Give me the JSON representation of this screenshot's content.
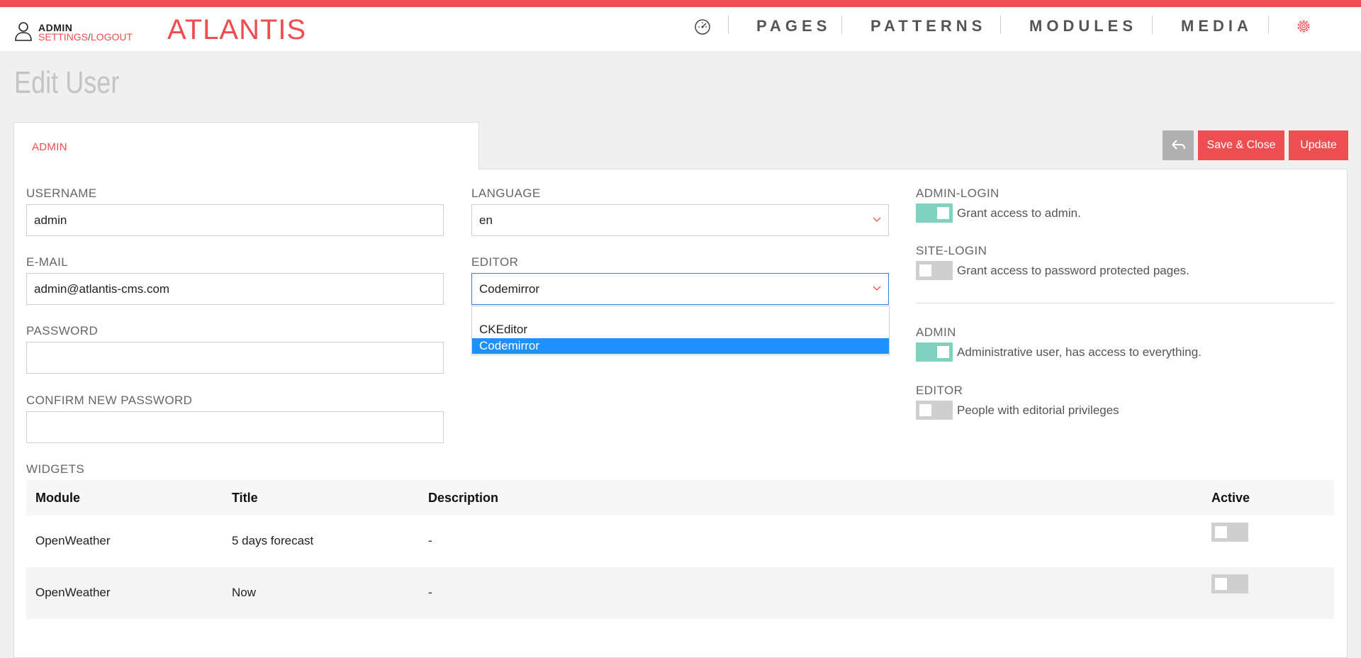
{
  "header": {
    "user_name": "ADMIN",
    "settings_link": "SETTINGS",
    "separator": "/",
    "logout_link": "LOGOUT",
    "logo": "ATLANTIS",
    "nav": [
      "PAGES",
      "PATTERNS",
      "MODULES",
      "MEDIA"
    ],
    "icons": {
      "user": "user-icon",
      "dashboard": "dashboard-gauge-icon",
      "settings": "gear-icon"
    },
    "accent_color": "#ef4e51"
  },
  "page": {
    "title": "Edit User"
  },
  "tab": {
    "label": "ADMIN"
  },
  "toolbar": {
    "back_icon": "reply-arrow-icon",
    "save_close": "Save & Close",
    "update": "Update"
  },
  "form": {
    "username_label": "USERNAME",
    "username_value": "admin",
    "email_label": "E-MAIL",
    "email_value": "admin@atlantis-cms.com",
    "password_label": "PASSWORD",
    "password_value": "",
    "confirm_label": "CONFIRM NEW PASSWORD",
    "confirm_value": "",
    "language_label": "LANGUAGE",
    "language_value": "en",
    "editor_label": "EDITOR",
    "editor_value": "Codemirror",
    "editor_options": [
      "CKEditor",
      "Codemirror"
    ],
    "editor_selected_option": "Codemirror"
  },
  "permissions": [
    {
      "label": "ADMIN-LOGIN",
      "description": "Grant access to admin.",
      "enabled": true
    },
    {
      "label": "SITE-LOGIN",
      "description": "Grant access to password protected pages.",
      "enabled": false
    },
    {
      "label": "ADMIN",
      "description": "Administrative user, has access to everything.",
      "enabled": true
    },
    {
      "label": "EDITOR",
      "description": "People with editorial privileges",
      "enabled": false
    }
  ],
  "toggle_colors": {
    "on": "#7ed3bf",
    "off": "#cfcfcf"
  },
  "widgets": {
    "label": "WIDGETS",
    "columns": [
      "Module",
      "Title",
      "Description",
      "Active"
    ],
    "rows": [
      {
        "module": "OpenWeather",
        "title": "5 days forecast",
        "description": "-",
        "active": false
      },
      {
        "module": "OpenWeather",
        "title": "Now",
        "description": "-",
        "active": false
      }
    ]
  }
}
